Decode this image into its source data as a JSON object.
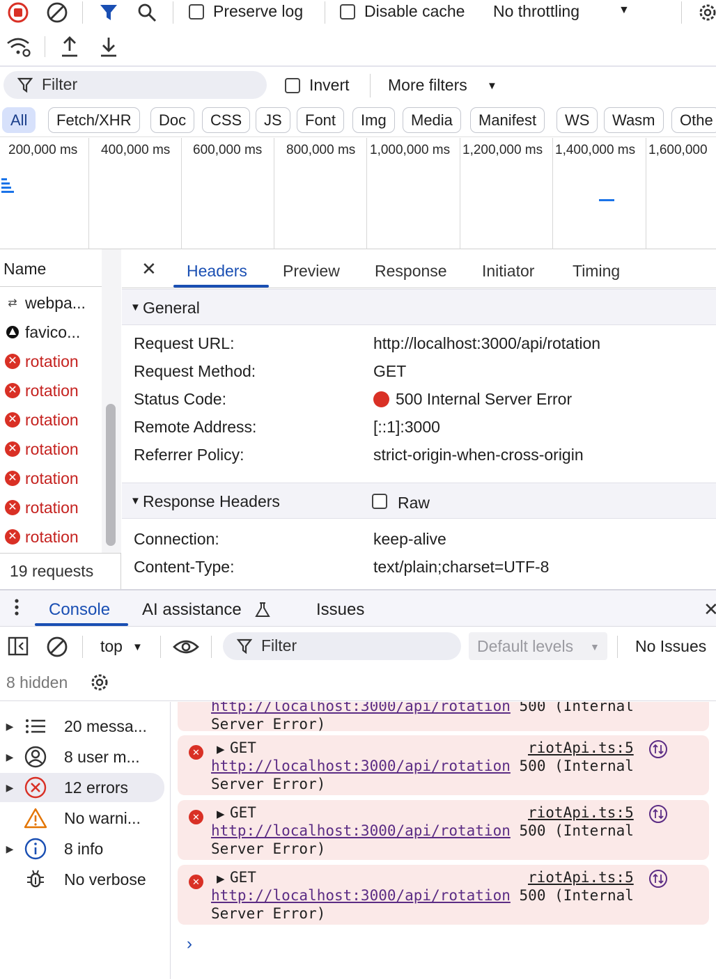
{
  "network_toolbar": {
    "preserve_log": "Preserve log",
    "disable_cache": "Disable cache",
    "throttling": "No throttling"
  },
  "filter_bar": {
    "filter_placeholder": "Filter",
    "invert": "Invert",
    "more_filters": "More filters"
  },
  "type_filters": [
    "All",
    "Fetch/XHR",
    "Doc",
    "CSS",
    "JS",
    "Font",
    "Img",
    "Media",
    "Manifest",
    "WS",
    "Wasm",
    "Othe"
  ],
  "overview_ticks": [
    "200,000 ms",
    "400,000 ms",
    "600,000 ms",
    "800,000 ms",
    "1,000,000 ms",
    "1,200,000 ms",
    "1,400,000 ms",
    "1,600,000"
  ],
  "request_list": {
    "header": "Name",
    "items": [
      {
        "name": "webpa...",
        "type": "ws"
      },
      {
        "name": "favico...",
        "type": "icon"
      },
      {
        "name": "rotation",
        "type": "error"
      },
      {
        "name": "rotation",
        "type": "error"
      },
      {
        "name": "rotation",
        "type": "error"
      },
      {
        "name": "rotation",
        "type": "error"
      },
      {
        "name": "rotation",
        "type": "error"
      },
      {
        "name": "rotation",
        "type": "error"
      },
      {
        "name": "rotation",
        "type": "error"
      }
    ],
    "footer": "19 requests"
  },
  "detail_tabs": [
    "Headers",
    "Preview",
    "Response",
    "Initiator",
    "Timing"
  ],
  "general": {
    "title": "General",
    "rows": [
      {
        "key": "Request URL:",
        "value": "http://localhost:3000/api/rotation"
      },
      {
        "key": "Request Method:",
        "value": "GET"
      },
      {
        "key": "Status Code:",
        "value": "500 Internal Server Error"
      },
      {
        "key": "Remote Address:",
        "value": "[::1]:3000"
      },
      {
        "key": "Referrer Policy:",
        "value": "strict-origin-when-cross-origin"
      }
    ]
  },
  "response_headers": {
    "title": "Response Headers",
    "raw": "Raw",
    "rows": [
      {
        "key": "Connection:",
        "value": "keep-alive"
      },
      {
        "key": "Content-Type:",
        "value": "text/plain;charset=UTF-8"
      }
    ]
  },
  "drawer": {
    "tabs": [
      "Console",
      "AI assistance",
      "Issues"
    ],
    "context": "top",
    "filter_placeholder": "Filter",
    "levels": "Default levels",
    "issues": "No Issues",
    "hidden": "8 hidden",
    "sidebar": [
      {
        "label": "20 messa...",
        "icon": "list-icon",
        "expandable": true
      },
      {
        "label": "8 user m...",
        "icon": "user-icon",
        "expandable": true
      },
      {
        "label": "12 errors",
        "icon": "error-icon",
        "expandable": true
      },
      {
        "label": "No warni...",
        "icon": "warning-icon",
        "expandable": false
      },
      {
        "label": "8 info",
        "icon": "info-icon",
        "expandable": true
      },
      {
        "label": "No verbose",
        "icon": "bug-icon",
        "expandable": false
      }
    ],
    "partial_message": {
      "url": "http://localhost:3000/api/rotation",
      "status": "500 (Internal",
      "line2": "Server Error)"
    },
    "messages": [
      {
        "method": "GET",
        "source": "riotApi.ts:5",
        "url": "http://localhost:3000/api/rotation",
        "status": "500 (Internal",
        "line2": "Server Error)"
      },
      {
        "method": "GET",
        "source": "riotApi.ts:5",
        "url": "http://localhost:3000/api/rotation",
        "status": "500 (Internal",
        "line2": "Server Error)"
      },
      {
        "method": "GET",
        "source": "riotApi.ts:5",
        "url": "http://localhost:3000/api/rotation",
        "status": "500 (Internal",
        "line2": "Server Error)"
      }
    ]
  },
  "colors": {
    "error": "#d93025",
    "accent": "#1a4fb3",
    "error_bg": "#fbe9e8"
  }
}
